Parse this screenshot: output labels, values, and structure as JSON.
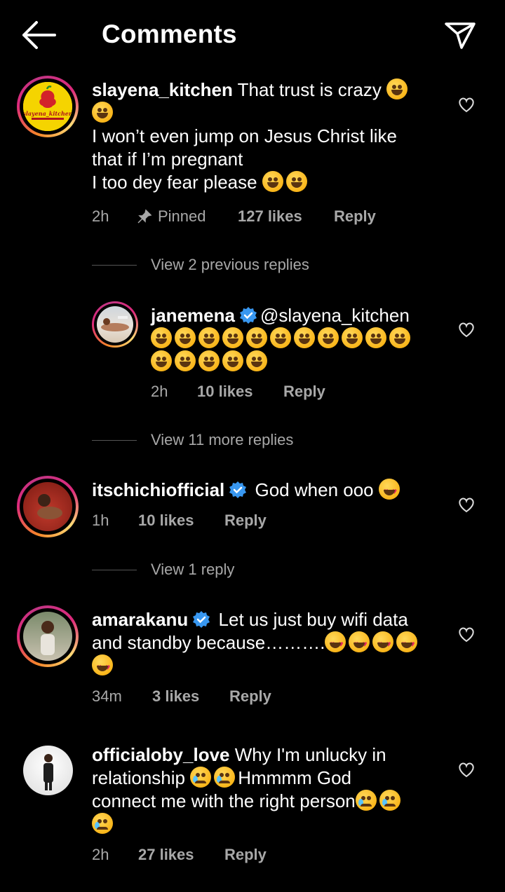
{
  "header": {
    "title": "Comments"
  },
  "comments": [
    {
      "username": "slayena_kitchen",
      "text_1": "That trust is crazy",
      "text_2": "I won’t even jump on Jesus Christ like",
      "text_3": "that if I’m pregnant",
      "text_4": "I too dey fear please",
      "time": "2h",
      "pinned": "Pinned",
      "likes": "127 likes",
      "reply": "Reply",
      "avatar_text": "slayena_kitchen"
    },
    {
      "view_replies": "View 2 previous replies"
    },
    {
      "username": "janemena",
      "mention": "@slayena_kitchen",
      "time": "2h",
      "likes": "10 likes",
      "reply": "Reply"
    },
    {
      "view_replies": "View 11 more replies"
    },
    {
      "username": "itschichiofficial",
      "text": "God when ooo",
      "time": "1h",
      "likes": "10 likes",
      "reply": "Reply"
    },
    {
      "view_replies": "View 1 reply"
    },
    {
      "username": "amarakanu",
      "text_1": "Let us just buy wifi data",
      "text_2": "and standby because……….",
      "time": "34m",
      "likes": "3 likes",
      "reply": "Reply"
    },
    {
      "username": "officialoby_love",
      "text_1": "Why I'm unlucky in",
      "text_2": "relationship",
      "text_3": "Hmmmm God",
      "text_4": "connect me with the right person",
      "time": "2h",
      "likes": "27 likes",
      "reply": "Reply"
    }
  ],
  "colors": {
    "background": "#000000",
    "text": "#ffffff",
    "secondary": "#a8a8a8",
    "verified": "#3897f0"
  },
  "icons": [
    "back-arrow-icon",
    "send-icon",
    "heart-icon",
    "pin-icon",
    "verified-badge-icon"
  ]
}
